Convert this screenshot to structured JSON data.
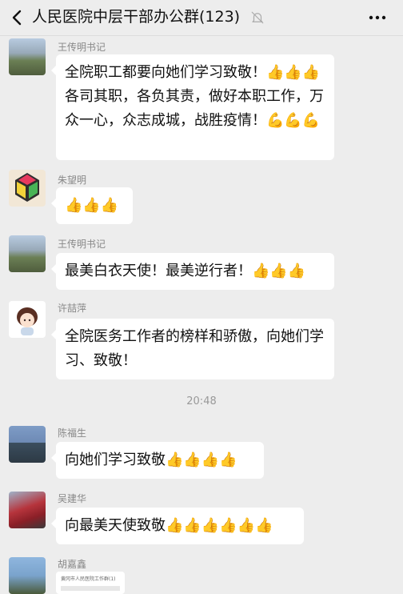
{
  "header": {
    "title": "人民医院中层干部办公群(123)"
  },
  "messages": [
    {
      "sender": "王传明书记",
      "text": "全院职工都要向她们学习致敬！👍👍👍各司其职，各负其责，做好本职工作，万众一心，众志成城，战胜疫情！💪💪💪"
    },
    {
      "sender": "朱望明",
      "text": "👍👍👍"
    },
    {
      "sender": "王传明书记",
      "text": "最美白衣天使！最美逆行者！👍👍👍"
    },
    {
      "sender": "许喆萍",
      "text": "全院医务工作者的榜样和骄傲，向她们学习、致敬！"
    },
    {
      "sender": "陈福生",
      "text": "向她们学习致敬👍👍👍👍"
    },
    {
      "sender": "吴建华",
      "text": "向最美天使致敬👍👍👍👍👍👍"
    },
    {
      "sender": "胡嘉鑫",
      "text": "",
      "preview_text": "黄冈市人民医院工作群(1)"
    }
  ],
  "time_divider": "20:48",
  "icons": {
    "back": "chevron-left-icon",
    "mute": "bell-off-icon",
    "more": "more-dots-icon"
  }
}
